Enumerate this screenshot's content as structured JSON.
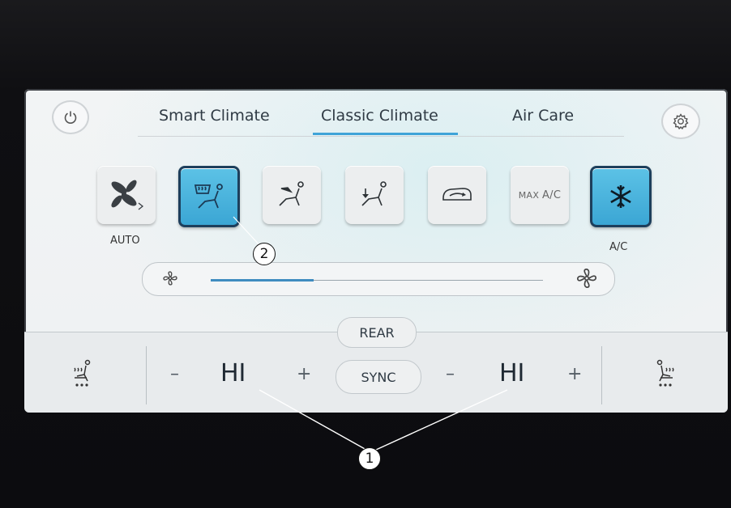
{
  "tabs": [
    {
      "label": "Smart Climate",
      "active": false
    },
    {
      "label": "Classic Climate",
      "active": true
    },
    {
      "label": "Air Care",
      "active": false
    }
  ],
  "modes": {
    "auto_label": "AUTO",
    "max_ac_prefix": "MAX",
    "max_ac_label": "A/C",
    "ac_label": "A/C",
    "windshield_defrost_active": true,
    "ac_active": true
  },
  "fan": {
    "level_fraction": 0.31
  },
  "bottom": {
    "rear_label": "REAR",
    "sync_label": "SYNC",
    "left_temp": "HI",
    "right_temp": "HI",
    "minus": "–",
    "plus": "+"
  },
  "callouts": {
    "one": "1",
    "two": "2"
  },
  "colors": {
    "accent": "#3fa3d8",
    "active_button": "#4db5df",
    "active_border": "#1d3f5c"
  },
  "icons": {
    "power": "power-icon",
    "settings": "gear-icon",
    "auto_fan": "fan-auto-icon",
    "defrost_windshield": "windshield-defrost-icon",
    "vent_face": "vent-face-icon",
    "vent_feet": "vent-feet-icon",
    "recirculation": "recirculation-icon",
    "ac": "snowflake-icon",
    "fan_small": "fan-small-icon",
    "fan_large": "fan-large-icon",
    "seat_heat_left": "seat-heat-left-icon",
    "seat_heat_right": "seat-heat-right-icon"
  }
}
